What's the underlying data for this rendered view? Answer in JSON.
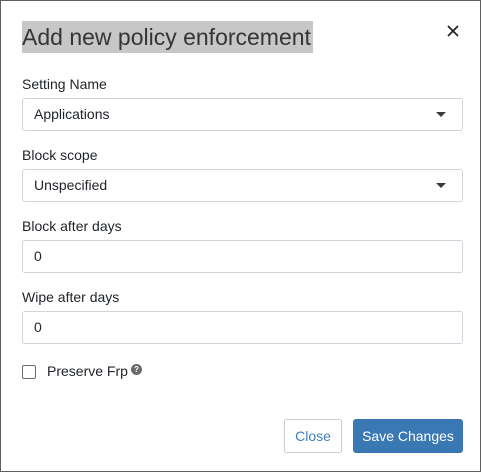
{
  "dialog": {
    "title": "Add new policy enforcement",
    "close_icon": "close-icon"
  },
  "fields": {
    "setting_name": {
      "label": "Setting Name",
      "value": "Applications"
    },
    "block_scope": {
      "label": "Block scope",
      "value": "Unspecified"
    },
    "block_after_days": {
      "label": "Block after days",
      "value": "0"
    },
    "wipe_after_days": {
      "label": "Wipe after days",
      "value": "0"
    }
  },
  "preserve_frp": {
    "label": "Preserve Frp",
    "checked": false,
    "help_icon": "question-circle-icon"
  },
  "footer": {
    "close_label": "Close",
    "save_label": "Save Changes"
  },
  "colors": {
    "primary": "#3a78b4",
    "title_highlight": "#c7c7c7",
    "border": "#ced4da"
  }
}
